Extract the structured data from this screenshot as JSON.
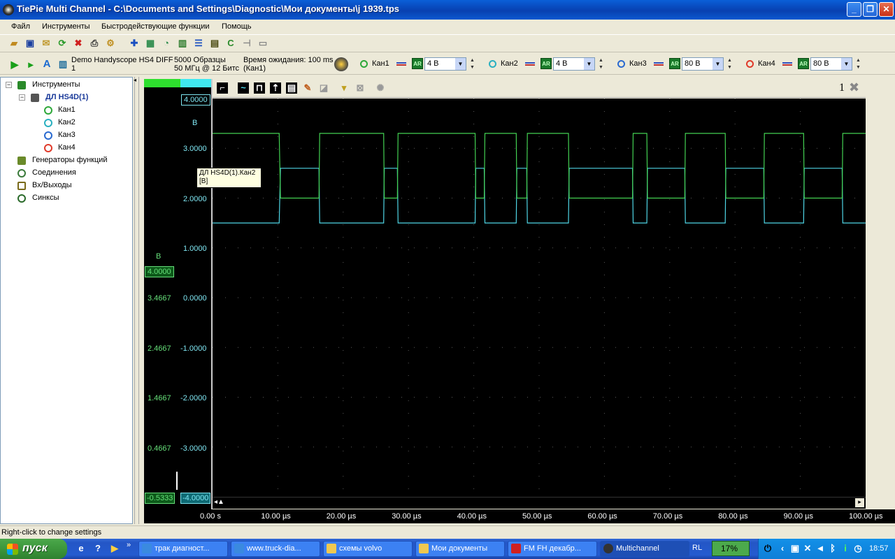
{
  "window": {
    "title": "TiePie Multi Channel - C:\\Documents and Settings\\Diagnostic\\Мои документы\\j 1939.tps",
    "minimize": "_",
    "maximize": "❐",
    "close": "✕"
  },
  "menu": [
    "Файл",
    "Инструменты",
    "Быстродействующие функции",
    "Помощь"
  ],
  "instrument": {
    "name_line1": "Demo Handyscope HS4 DIFF",
    "name_line2": "1",
    "samples": "5000 Образцы",
    "rate": "50 МГц @ 12 Битс",
    "wait_line1": "Время ожидания: 100 ms",
    "wait_line2": "(Кан1)"
  },
  "channels": [
    {
      "label": "Кан1",
      "range": "4 В",
      "color": "#2ea83a"
    },
    {
      "label": "Кан2",
      "range": "4 В",
      "color": "#2ab0c0"
    },
    {
      "label": "Кан3",
      "range": "80 В",
      "color": "#2a6ad0"
    },
    {
      "label": "Кан4",
      "range": "80 В",
      "color": "#e03a2a"
    }
  ],
  "ar_label": "AR",
  "tree": {
    "root": "Инструменты",
    "device": "ДЛ HS4D(1)",
    "channels": [
      "Кан1",
      "Кан2",
      "Кан3",
      "Кан4"
    ],
    "generators": "Генераторы функций",
    "connections": "Соединения",
    "io": "Вх/Выходы",
    "sync": "Синксы"
  },
  "scope": {
    "window_number": "1",
    "tooltip_line1": "ДЛ HS4D(1).Кан2",
    "tooltip_line2": "[В]",
    "cyan_unit": "В",
    "green_unit": "В",
    "cyan_top_box": "4.0000",
    "cyan_bottom_box": "-4.0000",
    "green_top_box": "4.0000",
    "green_bottom_box": "-0.5333",
    "cyan_axis": [
      "3.0000",
      "2.0000",
      "1.0000",
      "0.0000",
      "-1.0000",
      "-2.0000",
      "-3.0000"
    ],
    "green_axis": [
      "3.4667",
      "2.4667",
      "1.4667",
      "0.4667"
    ],
    "time_axis": [
      "0.00 s",
      "10.00 µs",
      "20.00 µs",
      "30.00 µs",
      "40.00 µs",
      "50.00 µs",
      "60.00 µs",
      "70.00 µs",
      "80.00 µs",
      "90.00 µs",
      "100.00 µs"
    ]
  },
  "chart_data": {
    "type": "line",
    "xlabel": "",
    "ylabel": "В",
    "x_unit": "µs",
    "xlim": [
      0,
      100
    ],
    "ylim": [
      -4,
      4
    ],
    "grid": true,
    "series": [
      {
        "name": "ДЛ HS4D(1).Кан2",
        "color": "#4fd6e6",
        "points": [
          [
            0,
            1.5
          ],
          [
            10.2,
            1.5
          ],
          [
            10.4,
            2.6
          ],
          [
            16.3,
            2.6
          ],
          [
            16.4,
            1.5
          ],
          [
            26.2,
            1.5
          ],
          [
            26.3,
            2.6
          ],
          [
            28.3,
            2.6
          ],
          [
            28.4,
            1.5
          ],
          [
            40.2,
            1.5
          ],
          [
            40.3,
            2.6
          ],
          [
            41.6,
            2.6
          ],
          [
            41.7,
            1.5
          ],
          [
            46.5,
            1.5
          ],
          [
            46.6,
            2.6
          ],
          [
            48.1,
            2.6
          ],
          [
            48.2,
            1.5
          ],
          [
            54.5,
            1.5
          ],
          [
            54.6,
            2.6
          ],
          [
            64.3,
            2.6
          ],
          [
            64.4,
            1.5
          ],
          [
            66.5,
            1.5
          ],
          [
            66.6,
            2.6
          ],
          [
            72.3,
            2.6
          ],
          [
            72.4,
            1.5
          ],
          [
            78.5,
            1.5
          ],
          [
            78.6,
            2.6
          ],
          [
            84.4,
            2.6
          ],
          [
            84.5,
            1.5
          ],
          [
            90.5,
            1.5
          ],
          [
            90.6,
            2.6
          ],
          [
            96.4,
            2.6
          ],
          [
            96.5,
            1.5
          ],
          [
            100,
            1.5
          ]
        ]
      },
      {
        "name": "",
        "color": "#43d152",
        "points": [
          [
            0,
            3.3
          ],
          [
            10.2,
            3.3
          ],
          [
            10.4,
            2.0
          ],
          [
            16.3,
            2.0
          ],
          [
            16.4,
            3.3
          ],
          [
            26.2,
            3.3
          ],
          [
            26.3,
            2.0
          ],
          [
            28.3,
            2.0
          ],
          [
            28.4,
            3.3
          ],
          [
            40.2,
            3.3
          ],
          [
            40.3,
            2.0
          ],
          [
            41.6,
            2.0
          ],
          [
            41.7,
            3.3
          ],
          [
            46.5,
            3.3
          ],
          [
            46.6,
            2.0
          ],
          [
            48.1,
            2.0
          ],
          [
            48.2,
            3.3
          ],
          [
            54.5,
            3.3
          ],
          [
            54.6,
            2.0
          ],
          [
            64.3,
            2.0
          ],
          [
            64.4,
            3.3
          ],
          [
            66.5,
            3.3
          ],
          [
            66.6,
            2.0
          ],
          [
            72.3,
            2.0
          ],
          [
            72.4,
            3.3
          ],
          [
            78.5,
            3.3
          ],
          [
            78.6,
            2.0
          ],
          [
            84.4,
            2.0
          ],
          [
            84.5,
            3.3
          ],
          [
            90.5,
            3.3
          ],
          [
            90.6,
            2.0
          ],
          [
            96.4,
            2.0
          ],
          [
            96.5,
            3.3
          ],
          [
            100,
            3.3
          ]
        ]
      }
    ]
  },
  "status": "Right-click to change settings",
  "taskbar": {
    "start": "пуск",
    "overflow": "»",
    "buttons": [
      "трак диагност...",
      "www.truck-dia...",
      "схемы volvo",
      "Мои документы",
      "FM FH декабр...",
      "Multichannel"
    ],
    "lang": "RL",
    "cpu": "17%",
    "clock": "18:57"
  }
}
